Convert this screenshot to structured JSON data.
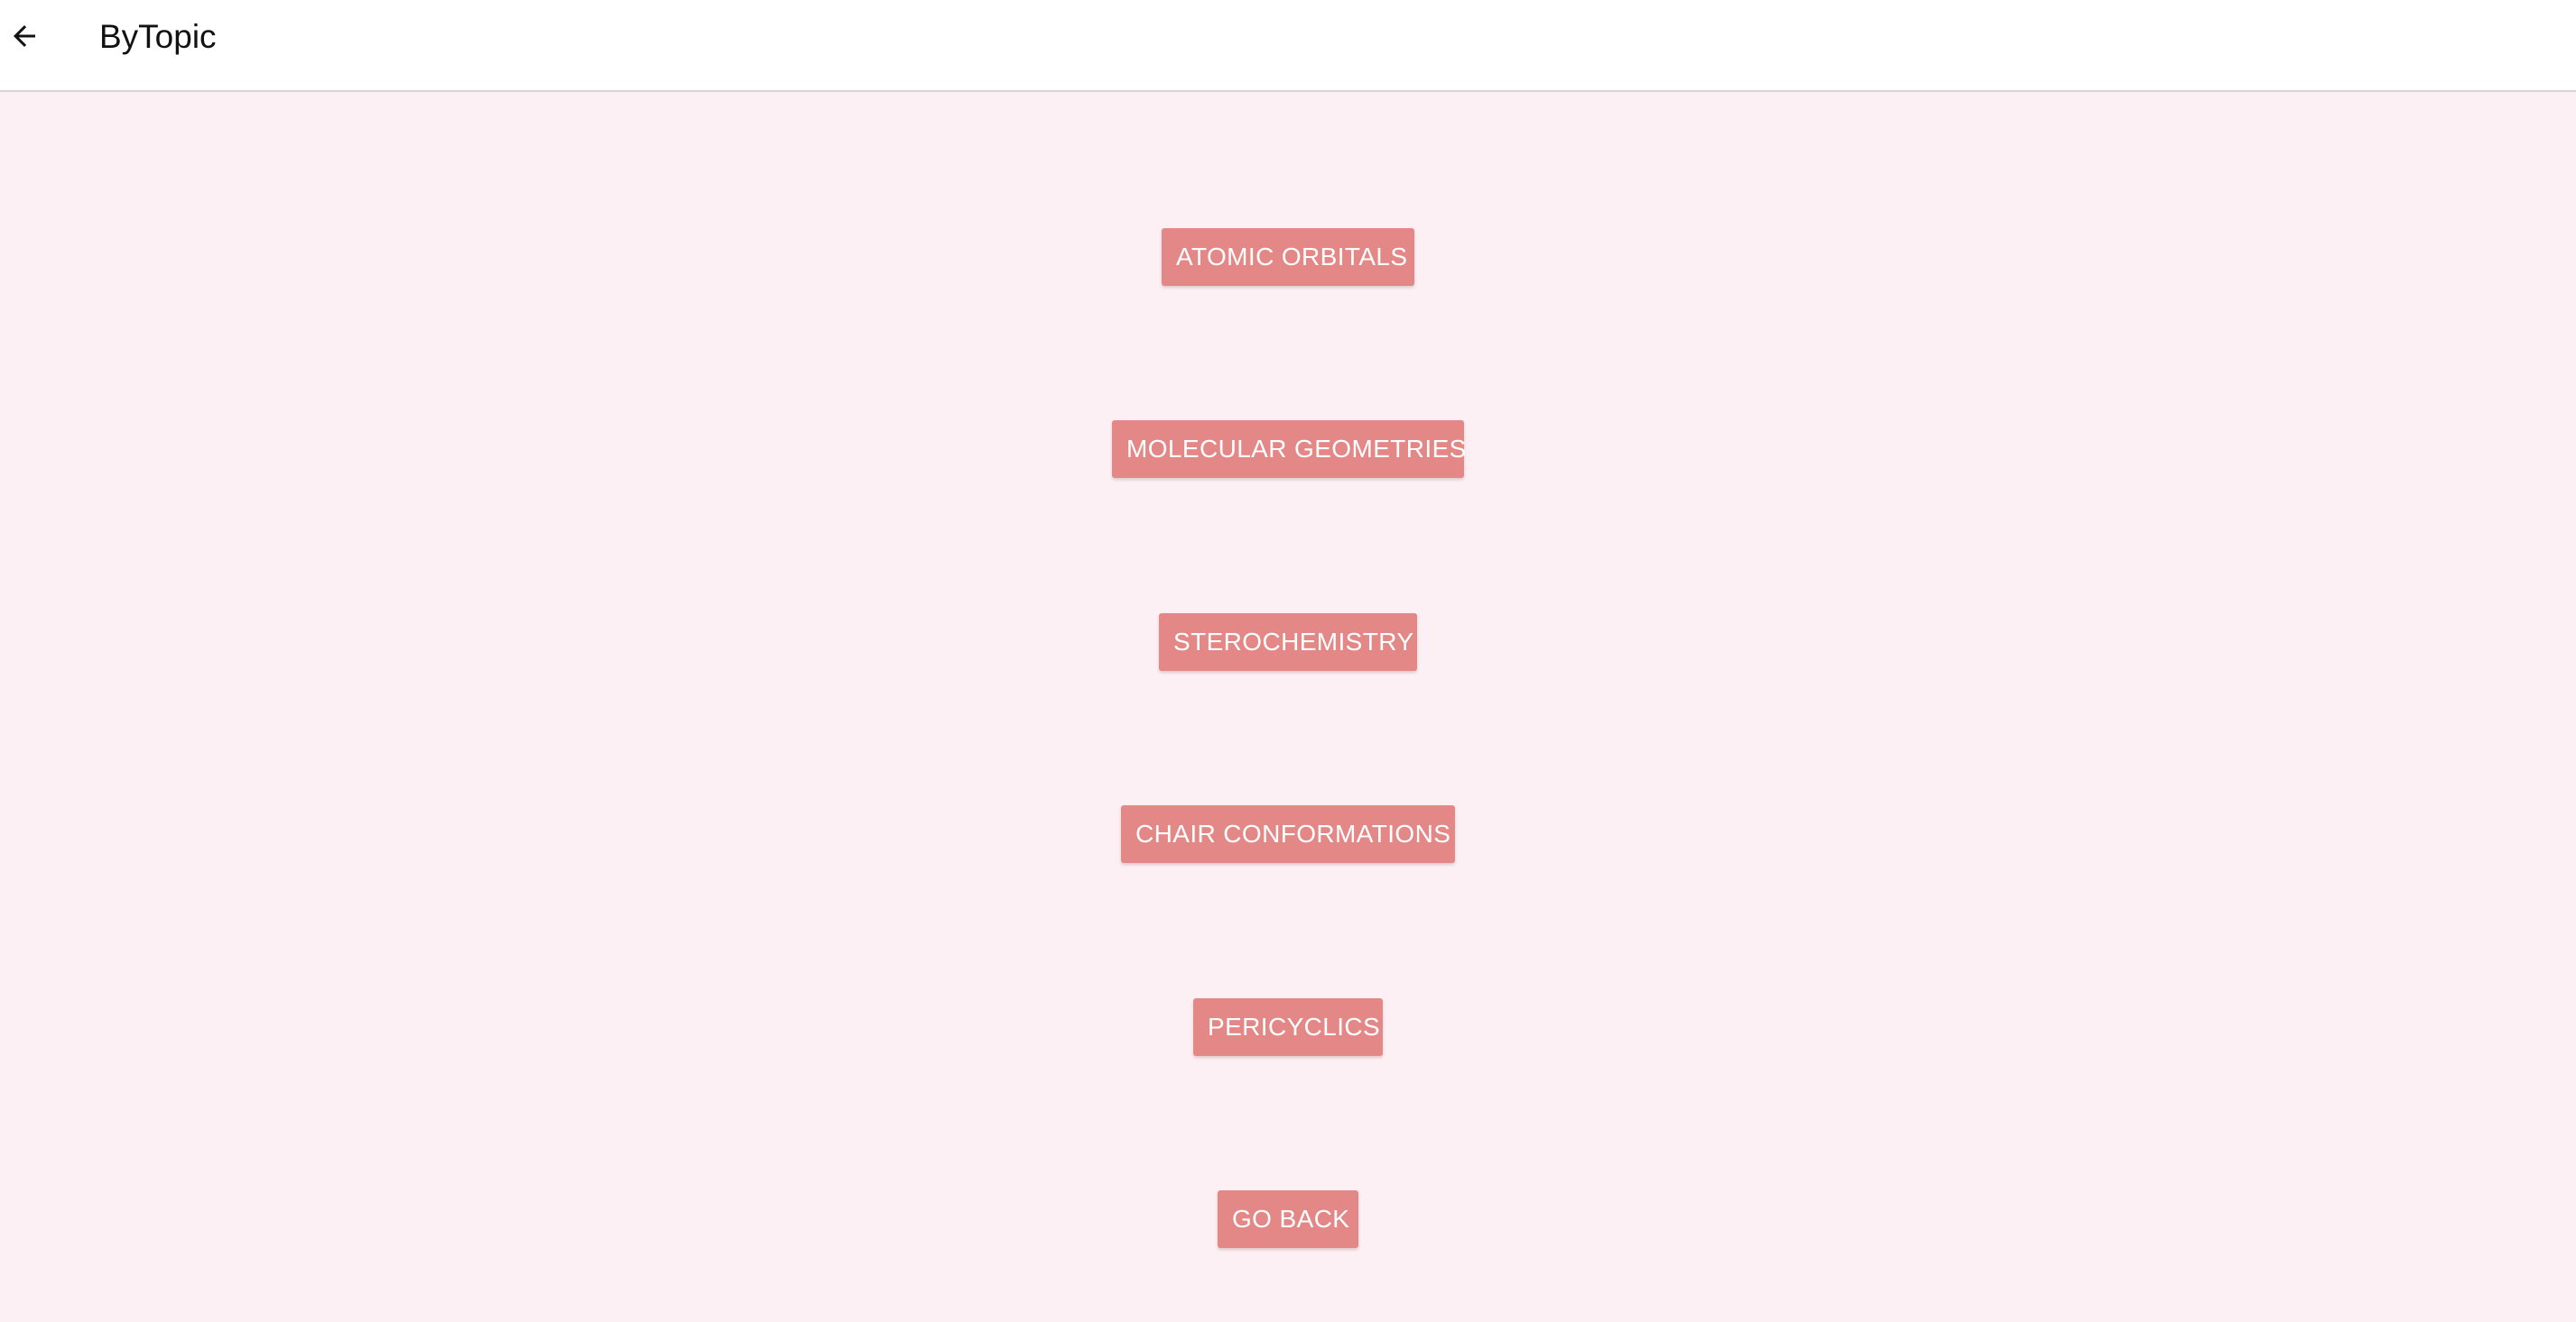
{
  "app_bar": {
    "title": "ByTopic",
    "back_icon": "arrow-left-icon"
  },
  "colors": {
    "app_bar_background": "#ffffff",
    "page_background": "#fcf0f4",
    "button_background": "#e38886",
    "button_text": "#ffffff"
  },
  "topics": [
    {
      "label": "ATOMIC ORBITALS"
    },
    {
      "label": "MOLECULAR GEOMETRIES"
    },
    {
      "label": "STEROCHEMISTRY"
    },
    {
      "label": "CHAIR CONFORMATIONS"
    },
    {
      "label": "PERICYCLICS"
    }
  ],
  "go_back": {
    "label": "GO BACK"
  }
}
